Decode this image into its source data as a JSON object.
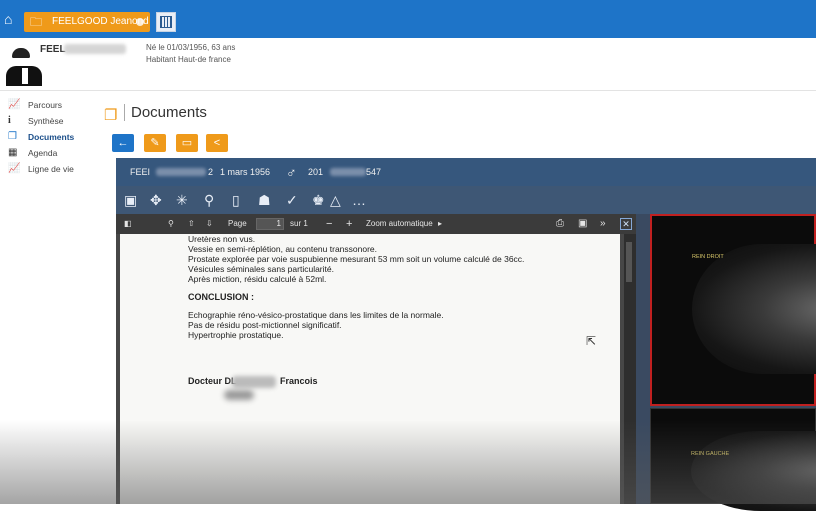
{
  "topbar": {
    "patient_tab": "FEELGOOD Jeanond",
    "home_icon": "home-icon",
    "folder_icon": "folder-icon",
    "calendar_icon": "calendar-icon"
  },
  "patient": {
    "name_visible": "FEEL",
    "birth": "Né le 01/03/1956, 63 ans",
    "location": "Habitant Haut-de france"
  },
  "sidebar": {
    "items": [
      {
        "label": "Parcours",
        "icon": "chart-icon"
      },
      {
        "label": "Synthèse",
        "icon": "info-icon"
      },
      {
        "label": "Documents",
        "icon": "documents-icon",
        "active": true
      },
      {
        "label": "Agenda",
        "icon": "calendar-icon"
      },
      {
        "label": "Ligne de vie",
        "icon": "chart-icon"
      }
    ]
  },
  "section": {
    "title": "Documents",
    "icon": "documents-icon"
  },
  "actions": {
    "back": "←",
    "edit": "✎",
    "open": "▭",
    "share": "<"
  },
  "viewer": {
    "header": {
      "name": "FEEI",
      "letter": "2",
      "date": "1 mars 1956",
      "sex": "♂",
      "id_start": "201",
      "id_end": "547"
    },
    "tools": [
      "▣",
      "✥",
      "✳",
      "⚲",
      "▯",
      "☗",
      "✓",
      "♚",
      "△",
      "…"
    ]
  },
  "pdf": {
    "page_label": "Page",
    "page_value": "1",
    "of_label": "sur 1",
    "minus": "−",
    "plus": "+",
    "zoom": "Zoom automatique",
    "lines": [
      "Uretères non vus.",
      "Vessie en semi-réplétion, au contenu transsonore.",
      "Prostate explorée par voie suspubienne mesurant 53 mm soit un volume calculé de 36cc.",
      "Vésicules séminales sans particularité.",
      "Après miction, résidu calculé à 52ml."
    ],
    "conclusion_title": "CONCLUSION :",
    "conclusion": [
      "Echographie réno-vésico-prostatique dans les limites de la normale.",
      "Pas de résidu post-mictionnel significatif.",
      "Hypertrophie prostatique."
    ],
    "doctor_prefix": "Docteur DL",
    "doctor_first": "Francois"
  },
  "images": [
    {
      "label": "REIN DROIT"
    },
    {
      "label": "REIN GAUCHE"
    }
  ],
  "colors": {
    "topbar": "#1e74c8",
    "accent_orange": "#ef9a1a",
    "viewer_header": "#36577d",
    "selected_border": "#c02020"
  }
}
